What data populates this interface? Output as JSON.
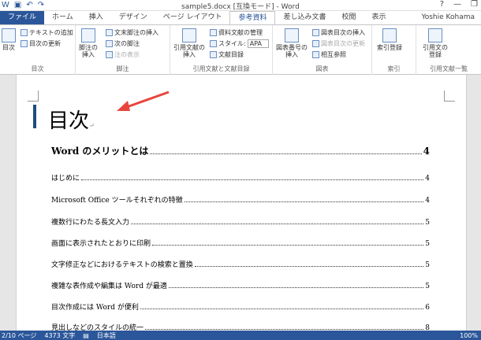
{
  "window": {
    "title": "sample5.docx [互換モード] - Word",
    "user": "Yoshie Kohama"
  },
  "tabs": [
    "ファイル",
    "ホーム",
    "挿入",
    "デザイン",
    "ページ レイアウト",
    "参考資料",
    "差し込み文書",
    "校閲",
    "表示"
  ],
  "ribbon": {
    "toc_group": {
      "label": "目次",
      "toc_btn": "目次",
      "add_text": "テキストの追加",
      "update_toc": "目次の更新"
    },
    "footnote_group": {
      "label": "脚注",
      "insert_footnote": "脚注の\n挿入",
      "insert_endnote": "文末脚注の挿入",
      "next_footnote": "次の脚注",
      "show_notes": "注の表示"
    },
    "citation_group": {
      "label": "引用文献と文献目録",
      "insert_citation": "引用文献の\n挿入",
      "manage_sources": "資料文献の管理",
      "style_label": "スタイル:",
      "style_value": "APA",
      "bibliography": "文献目録"
    },
    "captions_group": {
      "label": "図表",
      "insert_caption": "図表番号の\n挿入",
      "insert_table_figures": "図表目次の挿入",
      "update_table": "図表目次の更新",
      "cross_ref": "相互参照"
    },
    "index_group": {
      "label": "索引",
      "mark_entry": "索引登録"
    },
    "toa_group": {
      "label": "引用文献一覧",
      "mark_citation": "引用文の\n登録"
    }
  },
  "document": {
    "heading": "目次",
    "entries": [
      {
        "text": "Word のメリットとは",
        "page": "4",
        "level": 1
      },
      {
        "text": "はじめに",
        "page": "4",
        "level": 2
      },
      {
        "text": "Microsoft Office ツールそれぞれの特徴",
        "page": "4",
        "level": 2
      },
      {
        "text": "複数行にわたる長文入力",
        "page": "5",
        "level": 2
      },
      {
        "text": "画面に表示されたとおりに印刷",
        "page": "5",
        "level": 2
      },
      {
        "text": "文字修正などにおけるテキストの検索と置換",
        "page": "5",
        "level": 2
      },
      {
        "text": "複雑な表作成や編集は Word が最適",
        "page": "5",
        "level": 2
      },
      {
        "text": "目次作成には Word が便利",
        "page": "6",
        "level": 2
      },
      {
        "text": "見出しなどのスタイルの統一",
        "page": "8",
        "level": 2
      }
    ]
  },
  "status": {
    "page": "2/10 ページ",
    "words": "4373 文字",
    "lang": "日本語",
    "zoom": "100%"
  },
  "colors": {
    "accent": "#2b579a",
    "arrow": "#e8453c"
  }
}
